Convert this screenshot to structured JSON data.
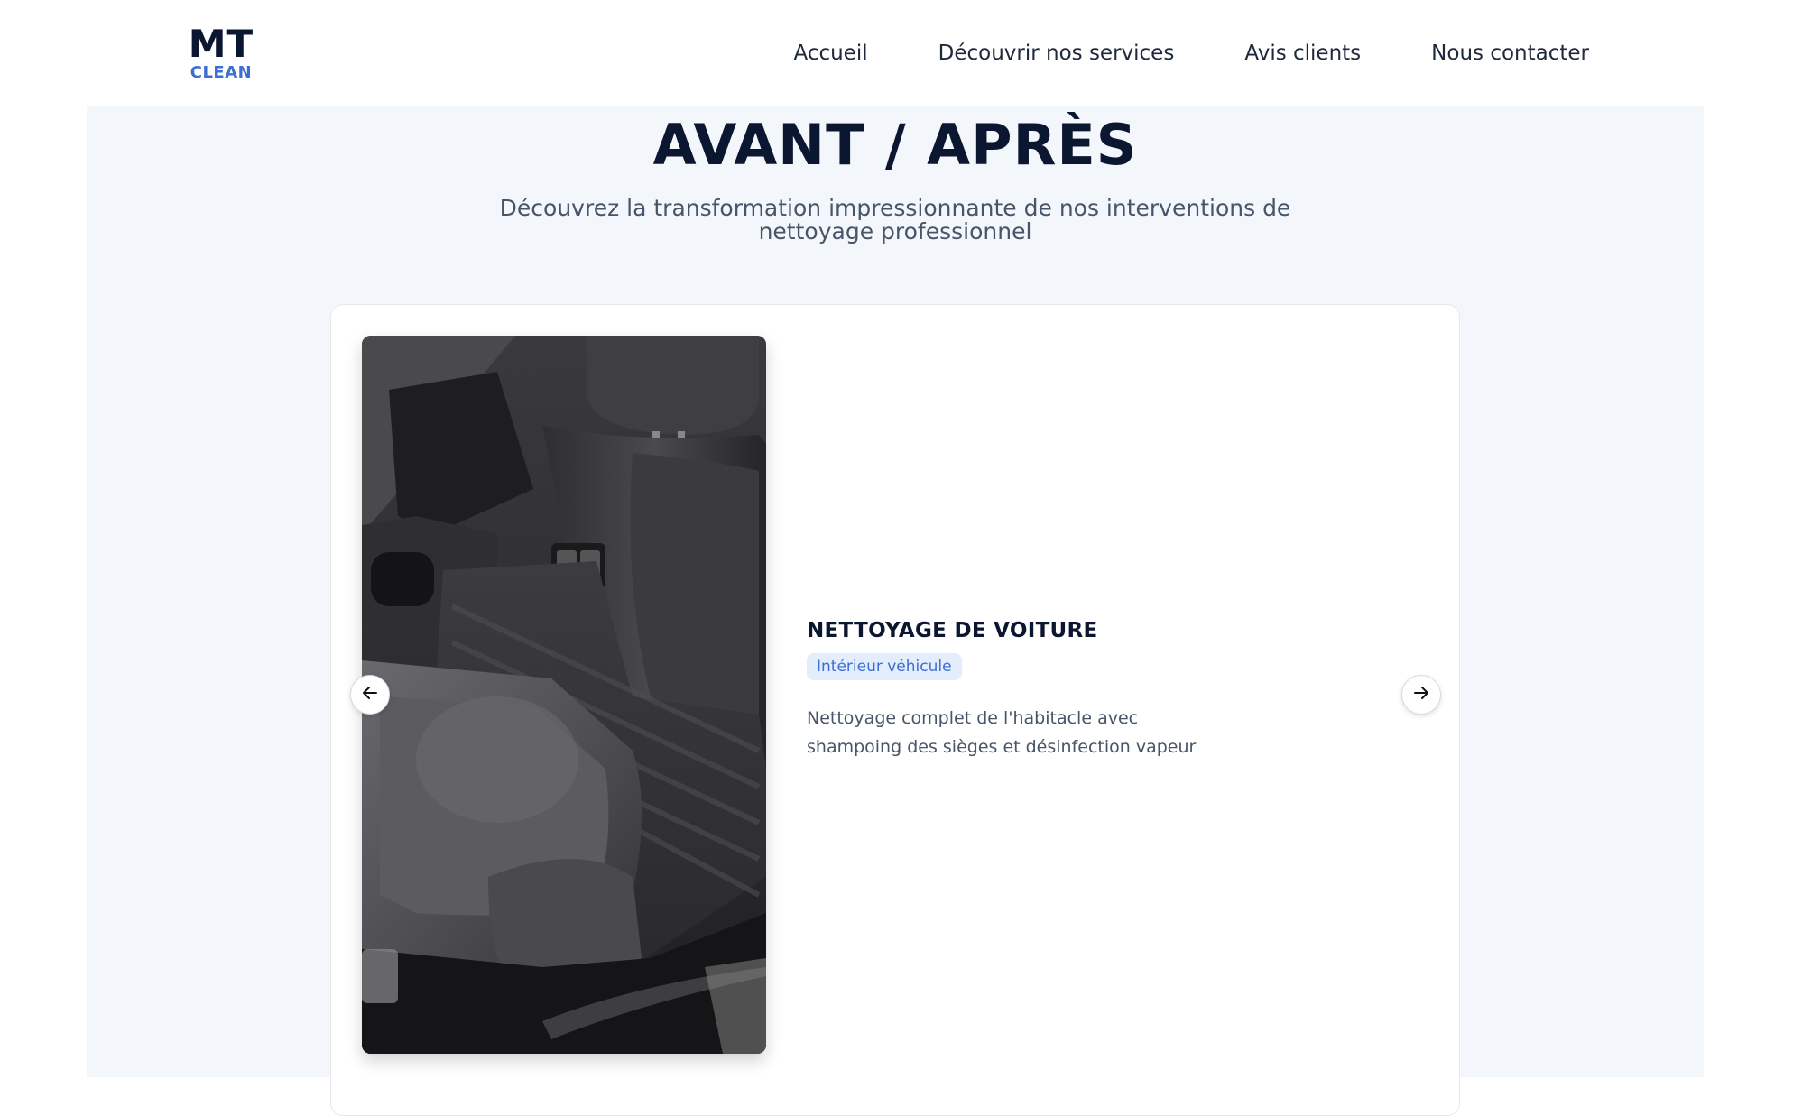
{
  "header": {
    "logo_top": "MT",
    "logo_bottom": "CLEAN",
    "nav": [
      {
        "label": "Accueil"
      },
      {
        "label": "Découvrir nos services"
      },
      {
        "label": "Avis clients"
      },
      {
        "label": "Nous contacter"
      }
    ]
  },
  "section": {
    "title": "AVANT / APRÈS",
    "subtitle": "Découvrez la transformation impressionnante de nos interventions de nettoyage professionnel"
  },
  "slide": {
    "title": "NETTOYAGE DE VOITURE",
    "badge": "Intérieur véhicule",
    "description": "Nettoyage complet de l'habitacle avec shampoing des sièges et désinfection vapeur"
  },
  "colors": {
    "brand_dark": "#0b1730",
    "accent_blue": "#3b6fd4",
    "badge_bg": "#e3edfb",
    "section_bg": "#f3f7fb"
  },
  "icons": {
    "prev": "arrow-left-icon",
    "next": "arrow-right-icon"
  }
}
